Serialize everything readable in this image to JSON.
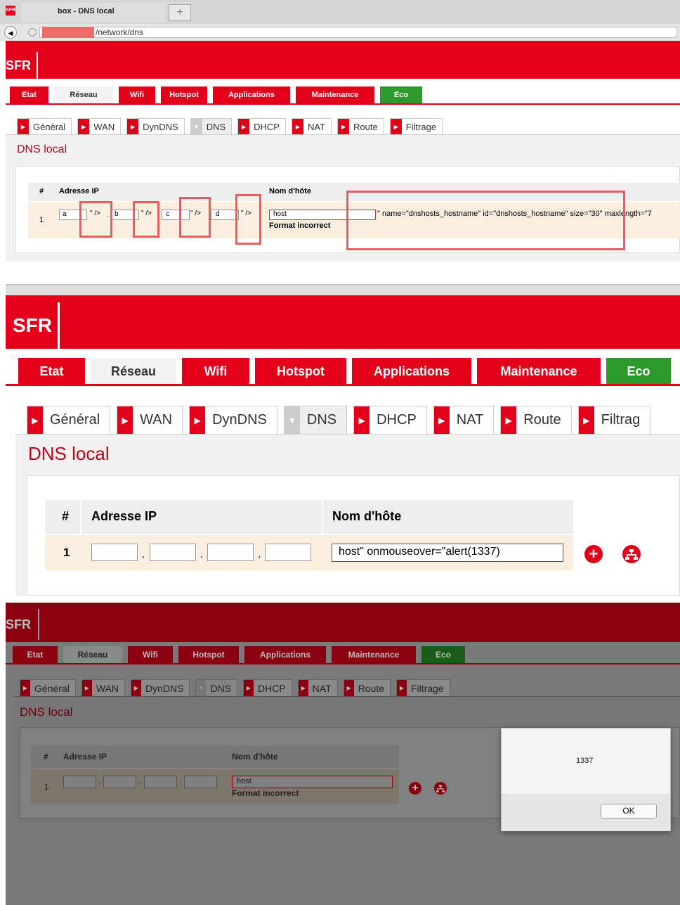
{
  "browser": {
    "tab_title": "box - DNS local",
    "url_path": "/network/dns",
    "new_tab": "+"
  },
  "brand": "SFR",
  "nav": [
    "Etat",
    "Réseau",
    "Wifi",
    "Hotspot",
    "Applications",
    "Maintenance",
    "Eco"
  ],
  "subtabs": [
    "Général",
    "WAN",
    "DynDNS",
    "DNS",
    "DHCP",
    "NAT",
    "Route",
    "Filtrage"
  ],
  "subtabs_truncated": [
    "Général",
    "WAN",
    "DynDNS",
    "DNS",
    "DHCP",
    "NAT",
    "Route",
    "Filtrag"
  ],
  "panel_title": "DNS local",
  "table": {
    "col_num": "#",
    "col_ip": "Adresse IP",
    "col_host": "Nom d'hôte"
  },
  "shot1": {
    "row_num": "1",
    "ip_values": [
      "a",
      "b",
      "c",
      "d"
    ],
    "ip_leak": "\" />",
    "dot": ".",
    "host_value": "host",
    "host_leak": "\" name=\"dnshosts_hostname\" id=\"dnshosts_hostname\" size=\"30\" maxlength=\"7",
    "error": "Format incorrect"
  },
  "shot2": {
    "row_num": "1",
    "dot": ".",
    "host_value": "host\" onmouseover=\"alert(1337)"
  },
  "shot3": {
    "row_num": "1",
    "dot": ".",
    "host_value": "host",
    "error": "Format incorrect",
    "alert_message": "1337",
    "ok_label": "OK"
  },
  "colors": {
    "sfr_red": "#e2001a",
    "eco_green": "#2e9a2e",
    "highlight": "#f05a5a"
  },
  "icons": [
    "add-icon",
    "network-icon",
    "back-icon",
    "globe-icon",
    "sfr-favicon"
  ]
}
